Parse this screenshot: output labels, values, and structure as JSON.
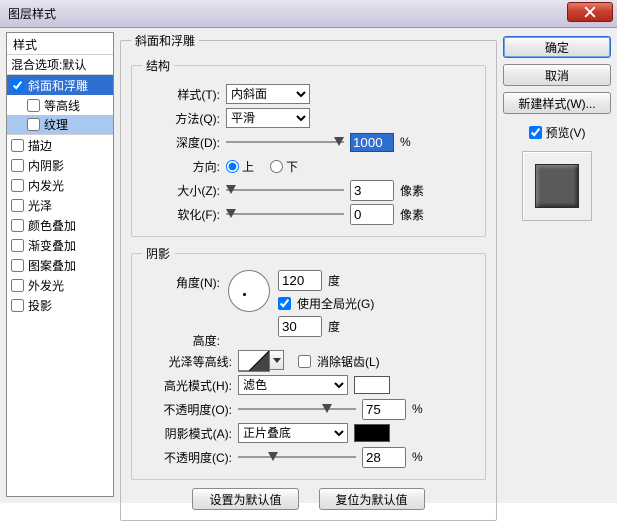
{
  "window": {
    "title": "图层样式"
  },
  "styles": {
    "header": "样式",
    "blend_defaults": "混合选项:默认",
    "bevel": "斜面和浮雕",
    "contour": "等高线",
    "texture": "纹理",
    "stroke": "描边",
    "inner_shadow": "内阴影",
    "inner_glow": "内发光",
    "satin": "光泽",
    "color_overlay": "颜色叠加",
    "gradient_overlay": "渐变叠加",
    "pattern_overlay": "图案叠加",
    "outer_glow": "外发光",
    "drop_shadow": "投影"
  },
  "bevel": {
    "group_title": "斜面和浮雕",
    "structure_title": "结构",
    "style_label": "样式(T):",
    "style_value": "内斜面",
    "technique_label": "方法(Q):",
    "technique_value": "平滑",
    "depth_label": "深度(D):",
    "depth_value": "1000",
    "percent": "%",
    "direction_label": "方向:",
    "direction_up": "上",
    "direction_down": "下",
    "size_label": "大小(Z):",
    "size_value": "3",
    "pixels": "像素",
    "soften_label": "软化(F):",
    "soften_value": "0",
    "shading_title": "阴影",
    "angle_label": "角度(N):",
    "angle_value": "120",
    "degree": "度",
    "use_global_light": "使用全局光(G)",
    "altitude_label": "高度:",
    "altitude_value": "30",
    "gloss_contour_label": "光泽等高线:",
    "antialias": "消除锯齿(L)",
    "highlight_mode_label": "高光模式(H):",
    "highlight_mode_value": "滤色",
    "highlight_opacity_label": "不透明度(O):",
    "highlight_opacity_value": "75",
    "shadow_mode_label": "阴影模式(A):",
    "shadow_mode_value": "正片叠底",
    "shadow_opacity_label": "不透明度(C):",
    "shadow_opacity_value": "28",
    "highlight_color": "#ffffff",
    "shadow_color": "#000000"
  },
  "buttons": {
    "ok": "确定",
    "cancel": "取消",
    "new_style": "新建样式(W)...",
    "preview": "预览(V)",
    "make_default": "设置为默认值",
    "reset_default": "复位为默认值"
  }
}
